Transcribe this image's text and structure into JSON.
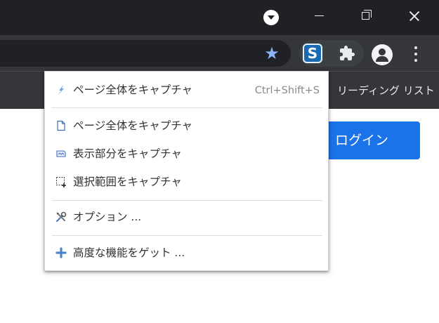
{
  "toolbar": {
    "reading_list_label": "リーディング リスト"
  },
  "page": {
    "login_label": "ログイン"
  },
  "menu": {
    "items": [
      {
        "label": "ページ全体をキャプチャ",
        "shortcut": "Ctrl+Shift+S",
        "icon": "lightning-icon"
      },
      {
        "label": "ページ全体をキャプチャ",
        "icon": "page-icon"
      },
      {
        "label": "表示部分をキャプチャ",
        "icon": "visible-area-icon"
      },
      {
        "label": "選択範囲をキャプチャ",
        "icon": "selection-icon"
      },
      {
        "label": "オプション ...",
        "icon": "tools-icon"
      },
      {
        "label": "高度な機能をゲット ...",
        "icon": "plus-icon"
      }
    ]
  },
  "extension": {
    "badge_letter": "S"
  },
  "colors": {
    "accent": "#1a73e8",
    "titlebar": "#202124",
    "toolbar": "#35363a",
    "star": "#8ab4f8"
  }
}
